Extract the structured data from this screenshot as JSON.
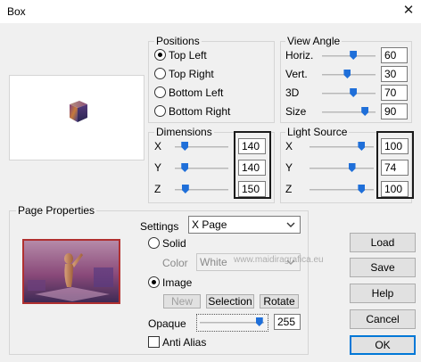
{
  "window": {
    "title": "Box",
    "close_glyph": "✕"
  },
  "positions": {
    "legend": "Positions",
    "options": [
      "Top Left",
      "Top Right",
      "Bottom Left",
      "Bottom Right"
    ],
    "selected": "Top Left"
  },
  "view_angle": {
    "legend": "View Angle",
    "rows": [
      {
        "label": "Horiz.",
        "value": "60",
        "level": 0.6
      },
      {
        "label": "Vert.",
        "value": "30",
        "level": 0.47
      },
      {
        "label": "3D",
        "value": "70",
        "level": 0.6
      },
      {
        "label": "Size",
        "value": "90",
        "level": 0.85
      }
    ]
  },
  "dimensions": {
    "legend": "Dimensions",
    "rows": [
      {
        "label": "X",
        "value": "140",
        "level": 0.14
      },
      {
        "label": "Y",
        "value": "140",
        "level": 0.14
      },
      {
        "label": "Z",
        "value": "150",
        "level": 0.15
      }
    ]
  },
  "light_source": {
    "legend": "Light Source",
    "rows": [
      {
        "label": "X",
        "value": "100",
        "level": 0.85
      },
      {
        "label": "Y",
        "value": "74",
        "level": 0.68
      },
      {
        "label": "Z",
        "value": "100",
        "level": 0.85
      }
    ]
  },
  "page_properties": {
    "legend": "Page Properties",
    "settings_label": "Settings",
    "settings_value": "X Page",
    "solid_label": "Solid",
    "color_label": "Color",
    "color_value": "White",
    "image_label": "Image",
    "selected": "Image",
    "new_label": "New",
    "selection_label": "Selection",
    "rotate_label": "Rotate",
    "opaque_label": "Opaque",
    "opaque_value": "255",
    "opaque_level": 0.98,
    "anti_alias_label": "Anti Alias",
    "anti_alias_checked": false
  },
  "buttons": {
    "load": "Load",
    "save": "Save",
    "help": "Help",
    "cancel": "Cancel",
    "ok": "OK"
  },
  "watermark": "www.maidiragrafica.eu",
  "colors": {
    "accent": "#1f6fd9",
    "default_border": "#0078d7",
    "highlight_box": "#1a1a1a"
  },
  "icons": {
    "close": "close-icon",
    "dropdown": "chevron-down-icon"
  }
}
